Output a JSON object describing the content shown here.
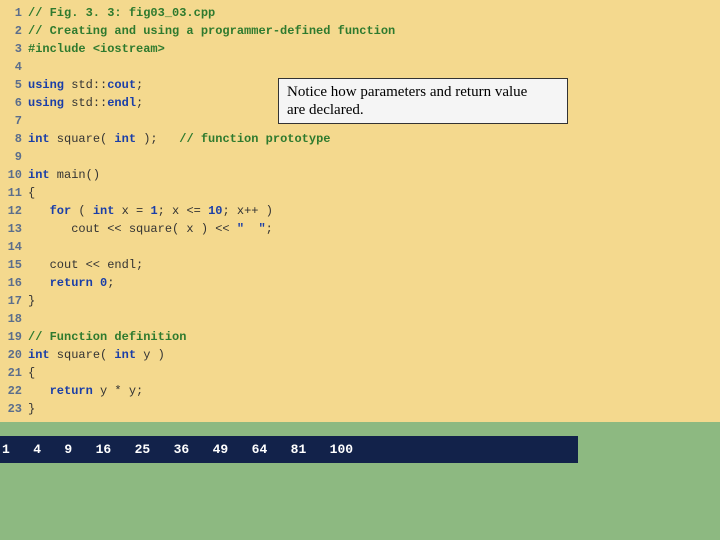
{
  "callout": {
    "line1": "Notice how parameters and return value",
    "line2": "are declared."
  },
  "lines": [
    {
      "n": "1",
      "segs": [
        {
          "c": "comment",
          "t": "// Fig. 3. 3: fig03_03.cpp"
        }
      ]
    },
    {
      "n": "2",
      "segs": [
        {
          "c": "comment",
          "t": "// Creating and using a programmer-defined function"
        }
      ]
    },
    {
      "n": "3",
      "segs": [
        {
          "c": "preproc",
          "t": "#include "
        },
        {
          "c": "preproc",
          "t": "<iostream>"
        }
      ]
    },
    {
      "n": "4",
      "segs": []
    },
    {
      "n": "5",
      "segs": [
        {
          "c": "kw",
          "t": "using"
        },
        {
          "t": " std::"
        },
        {
          "c": "kw",
          "t": "cout"
        },
        {
          "t": ";"
        }
      ]
    },
    {
      "n": "6",
      "segs": [
        {
          "c": "kw",
          "t": "using"
        },
        {
          "t": " std::"
        },
        {
          "c": "kw",
          "t": "endl"
        },
        {
          "t": ";"
        }
      ]
    },
    {
      "n": "7",
      "segs": []
    },
    {
      "n": "8",
      "segs": [
        {
          "c": "kw",
          "t": "int"
        },
        {
          "t": " square( "
        },
        {
          "c": "kw",
          "t": "int"
        },
        {
          "t": " );   "
        },
        {
          "c": "comment",
          "t": "// function prototype"
        }
      ]
    },
    {
      "n": "9",
      "segs": []
    },
    {
      "n": "10",
      "segs": [
        {
          "c": "kw",
          "t": "int"
        },
        {
          "t": " main()"
        }
      ]
    },
    {
      "n": "11",
      "segs": [
        {
          "t": "{"
        }
      ]
    },
    {
      "n": "12",
      "segs": [
        {
          "t": "   "
        },
        {
          "c": "kw",
          "t": "for"
        },
        {
          "t": " ( "
        },
        {
          "c": "kw",
          "t": "int"
        },
        {
          "t": " x = "
        },
        {
          "c": "num",
          "t": "1"
        },
        {
          "t": "; x <= "
        },
        {
          "c": "num",
          "t": "10"
        },
        {
          "t": "; x++ )"
        }
      ]
    },
    {
      "n": "13",
      "segs": [
        {
          "t": "      cout << square( x ) << "
        },
        {
          "c": "str",
          "t": "\"  \""
        },
        {
          "t": ";"
        }
      ]
    },
    {
      "n": "14",
      "segs": []
    },
    {
      "n": "15",
      "segs": [
        {
          "t": "   cout << endl;"
        }
      ]
    },
    {
      "n": "16",
      "segs": [
        {
          "t": "   "
        },
        {
          "c": "kw",
          "t": "return"
        },
        {
          "t": " "
        },
        {
          "c": "num",
          "t": "0"
        },
        {
          "t": ";"
        }
      ]
    },
    {
      "n": "17",
      "segs": [
        {
          "t": "}"
        }
      ]
    },
    {
      "n": "18",
      "segs": []
    },
    {
      "n": "19",
      "segs": [
        {
          "c": "comment",
          "t": "// Function definition"
        }
      ]
    },
    {
      "n": "20",
      "segs": [
        {
          "c": "kw",
          "t": "int"
        },
        {
          "t": " square( "
        },
        {
          "c": "kw",
          "t": "int"
        },
        {
          "t": " y )"
        }
      ]
    },
    {
      "n": "21",
      "segs": [
        {
          "t": "{"
        }
      ]
    },
    {
      "n": "22",
      "segs": [
        {
          "t": "   "
        },
        {
          "c": "kw",
          "t": "return"
        },
        {
          "t": " y * y;"
        }
      ]
    },
    {
      "n": "23",
      "segs": [
        {
          "t": "}"
        }
      ]
    }
  ],
  "output": "1   4   9   16   25   36   49   64   81   100"
}
